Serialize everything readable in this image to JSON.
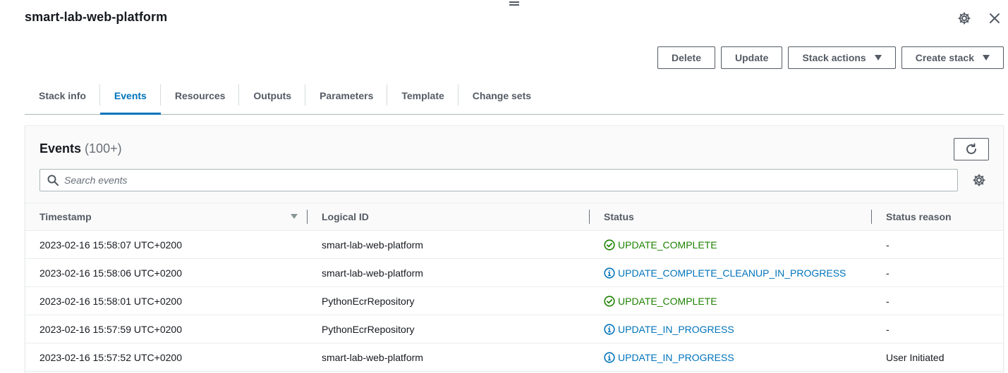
{
  "header": {
    "title": "smart-lab-web-platform"
  },
  "actions": {
    "delete_label": "Delete",
    "update_label": "Update",
    "stack_actions_label": "Stack actions",
    "create_stack_label": "Create stack"
  },
  "tabs": [
    {
      "label": "Stack info"
    },
    {
      "label": "Events"
    },
    {
      "label": "Resources"
    },
    {
      "label": "Outputs"
    },
    {
      "label": "Parameters"
    },
    {
      "label": "Template"
    },
    {
      "label": "Change sets"
    }
  ],
  "active_tab": "Events",
  "events": {
    "title": "Events",
    "count": "(100+)",
    "search_placeholder": "Search events",
    "columns": [
      "Timestamp",
      "Logical ID",
      "Status",
      "Status reason"
    ],
    "rows": [
      {
        "timestamp": "2023-02-16 15:58:07 UTC+0200",
        "logical_id": "smart-lab-web-platform",
        "status": "UPDATE_COMPLETE",
        "status_type": "success",
        "reason": "-"
      },
      {
        "timestamp": "2023-02-16 15:58:06 UTC+0200",
        "logical_id": "smart-lab-web-platform",
        "status": "UPDATE_COMPLETE_CLEANUP_IN_PROGRESS",
        "status_type": "info",
        "reason": "-"
      },
      {
        "timestamp": "2023-02-16 15:58:01 UTC+0200",
        "logical_id": "PythonEcrRepository",
        "status": "UPDATE_COMPLETE",
        "status_type": "success",
        "reason": "-"
      },
      {
        "timestamp": "2023-02-16 15:57:59 UTC+0200",
        "logical_id": "PythonEcrRepository",
        "status": "UPDATE_IN_PROGRESS",
        "status_type": "info",
        "reason": "-"
      },
      {
        "timestamp": "2023-02-16 15:57:52 UTC+0200",
        "logical_id": "smart-lab-web-platform",
        "status": "UPDATE_IN_PROGRESS",
        "status_type": "info",
        "reason": "User Initiated"
      }
    ]
  },
  "colors": {
    "accent": "#0073bb",
    "success": "#1d8102",
    "text": "#16191f",
    "muted": "#545b64"
  }
}
